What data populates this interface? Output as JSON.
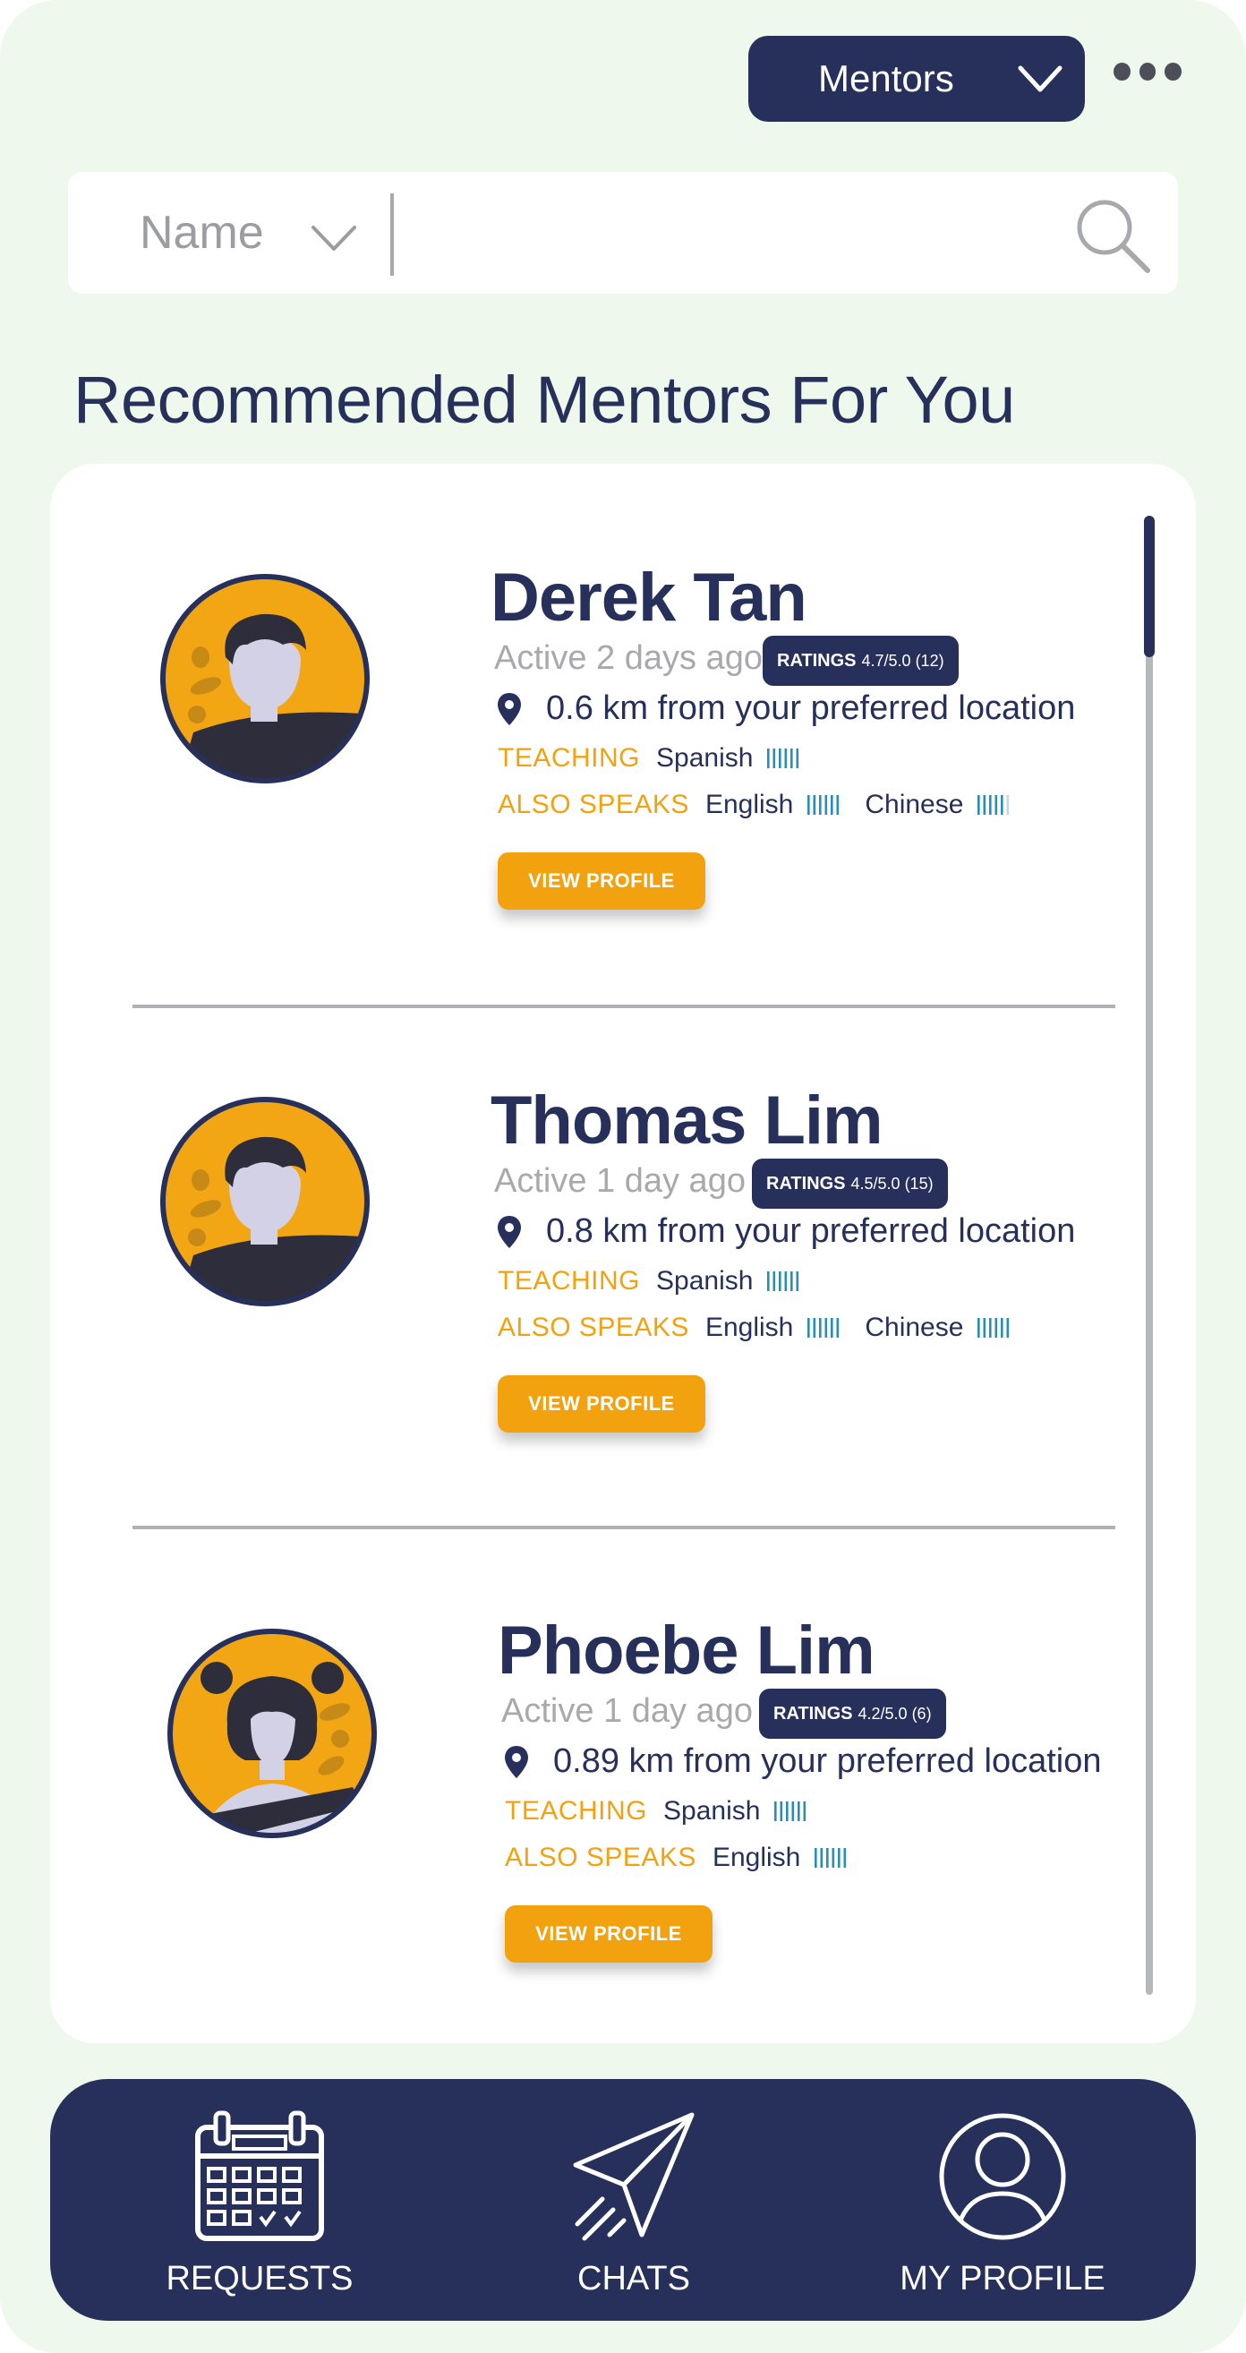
{
  "header": {
    "mode_selected": "Mentors",
    "more_icon": "more-horizontal-icon"
  },
  "search": {
    "field_selected": "Name",
    "value": "",
    "placeholder": "",
    "search_icon": "search-icon"
  },
  "section": {
    "title": "Recommended Mentors For You"
  },
  "mentors": [
    {
      "name": "Derek Tan",
      "active": "Active 2 days ago",
      "ratings_label": "RATINGS",
      "ratings_value": "4.7/5.0 (12)",
      "location": "0.6 km from your preferred location",
      "teaching_label": "TEACHING",
      "teaching": [
        {
          "language": "Spanish",
          "level": 6
        }
      ],
      "speaks_label": "ALSO SPEAKS",
      "speaks": [
        {
          "language": "English",
          "level": 6
        },
        {
          "language": "Chinese",
          "level": 5
        }
      ],
      "button": "VIEW PROFILE",
      "avatar": "male-avatar"
    },
    {
      "name": "Thomas Lim",
      "active": "Active 1 day ago",
      "ratings_label": "RATINGS",
      "ratings_value": "4.5/5.0 (15)",
      "location": "0.8 km from your preferred location",
      "teaching_label": "TEACHING",
      "teaching": [
        {
          "language": "Spanish",
          "level": 6
        }
      ],
      "speaks_label": "ALSO SPEAKS",
      "speaks": [
        {
          "language": "English",
          "level": 6
        },
        {
          "language": "Chinese",
          "level": 6
        }
      ],
      "button": "VIEW PROFILE",
      "avatar": "male-avatar"
    },
    {
      "name": "Phoebe Lim",
      "active": "Active 1 day ago",
      "ratings_label": "RATINGS",
      "ratings_value": "4.2/5.0 (6)",
      "location": "0.89 km from your preferred location",
      "teaching_label": "TEACHING",
      "teaching": [
        {
          "language": "Spanish",
          "level": 6
        }
      ],
      "speaks_label": "ALSO SPEAKS",
      "speaks": [
        {
          "language": "English",
          "level": 6
        }
      ],
      "button": "VIEW PROFILE",
      "avatar": "female-avatar"
    }
  ],
  "nav": {
    "requests": "REQUESTS",
    "chats": "CHATS",
    "profile": "MY PROFILE"
  },
  "colors": {
    "navy": "#27305a",
    "accent": "#f2a20f",
    "background": "#eff8ec",
    "level_bar": "#2a8db3"
  }
}
